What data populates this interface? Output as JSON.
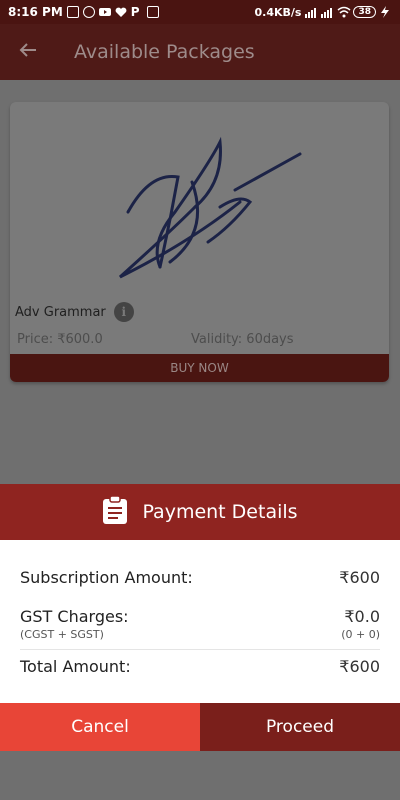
{
  "status_bar": {
    "time": "8:16 PM",
    "network_speed": "0.4KB/s",
    "battery": "38",
    "icons": [
      "news-icon",
      "game-icon",
      "youtube-icon",
      "heart-icon",
      "p-icon",
      "app-icon",
      "signal-icon",
      "wifi-icon",
      "battery-icon",
      "charging-icon"
    ]
  },
  "appbar": {
    "title": "Available Packages",
    "back_icon": "arrow-left-icon"
  },
  "package": {
    "name": "Adv Grammar",
    "price": "Price: ₹600.0",
    "validity": "Validity: 60days",
    "buy_label": "BUY NOW"
  },
  "payment": {
    "header_title": "Payment Details",
    "subscription_label": "Subscription Amount:",
    "subscription_value": "₹600",
    "gst_label": "GST Charges:",
    "gst_value": "₹0.0",
    "gst_sub_label": "(CGST + SGST)",
    "gst_sub_value": "(0 + 0)",
    "total_label": "Total Amount:",
    "total_value": "₹600",
    "cancel_label": "Cancel",
    "proceed_label": "Proceed"
  },
  "colors": {
    "appbar": "#4f1a17",
    "sheet_header": "#8f2420",
    "cancel": "#e84537",
    "proceed": "#7a1f1b"
  }
}
